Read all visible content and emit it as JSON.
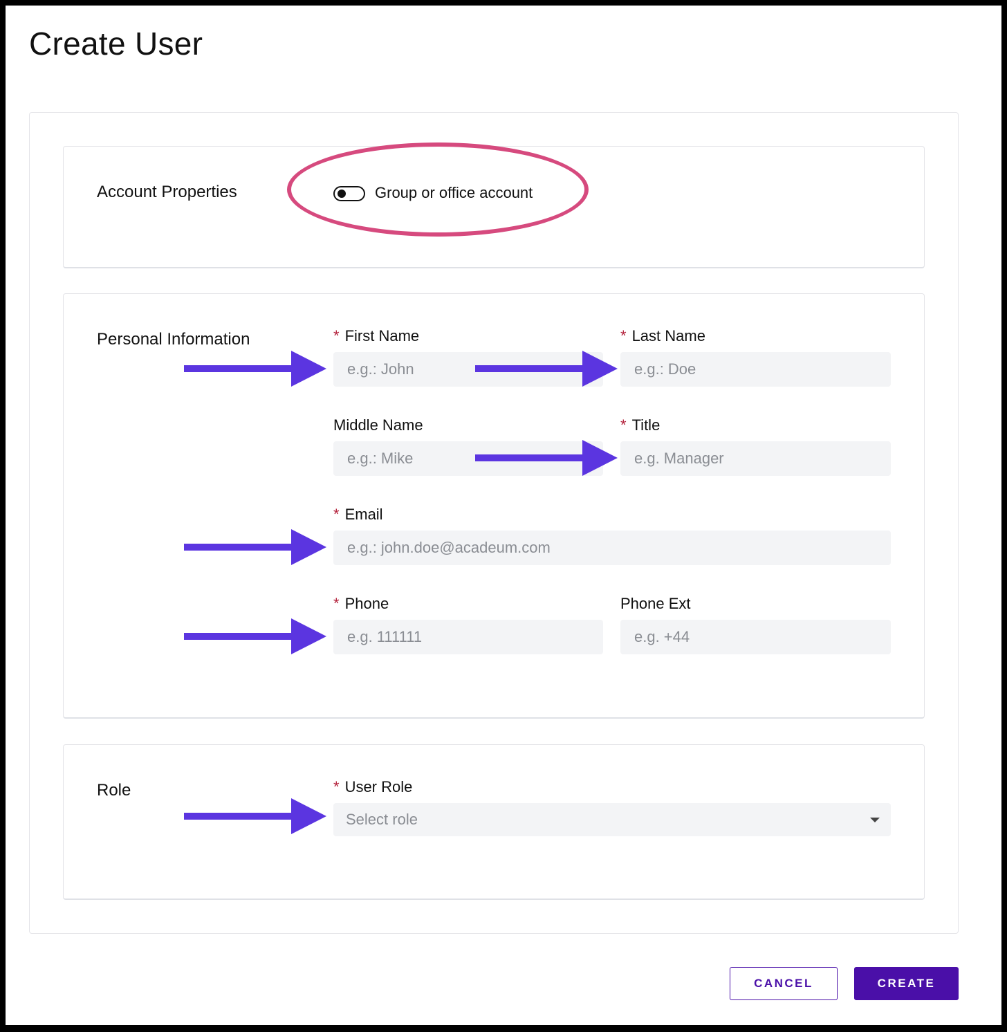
{
  "page": {
    "title": "Create User"
  },
  "account_properties": {
    "section_title": "Account Properties",
    "group_toggle": {
      "label": "Group or office account",
      "checked": false
    }
  },
  "personal_information": {
    "section_title": "Personal Information",
    "required_mark": "*",
    "first_name": {
      "label": "First Name",
      "placeholder": "e.g.: John",
      "required": true
    },
    "last_name": {
      "label": "Last Name",
      "placeholder": "e.g.: Doe",
      "required": true
    },
    "middle_name": {
      "label": "Middle Name",
      "placeholder": "e.g.: Mike",
      "required": false
    },
    "title": {
      "label": "Title",
      "placeholder": "e.g. Manager",
      "required": true
    },
    "email": {
      "label": "Email",
      "placeholder": "e.g.: john.doe@acadeum.com",
      "required": true
    },
    "phone": {
      "label": "Phone",
      "placeholder": "e.g. 111111",
      "required": true
    },
    "phone_ext": {
      "label": "Phone Ext",
      "placeholder": "e.g. +44",
      "required": false
    }
  },
  "role": {
    "section_title": "Role",
    "user_role": {
      "label": "User Role",
      "placeholder": "Select role",
      "required": true
    }
  },
  "actions": {
    "cancel_label": "CANCEL",
    "create_label": "CREATE"
  },
  "colors": {
    "brand_purple": "#4a0fa8",
    "annotation_arrow": "#5b35e0",
    "annotation_ellipse": "#d64a7e",
    "required_mark": "#b3203a",
    "input_bg": "#f3f4f6"
  },
  "icons": {
    "select_caret": "caret-down-icon",
    "annotation_arrow": "arrow-right-icon"
  }
}
